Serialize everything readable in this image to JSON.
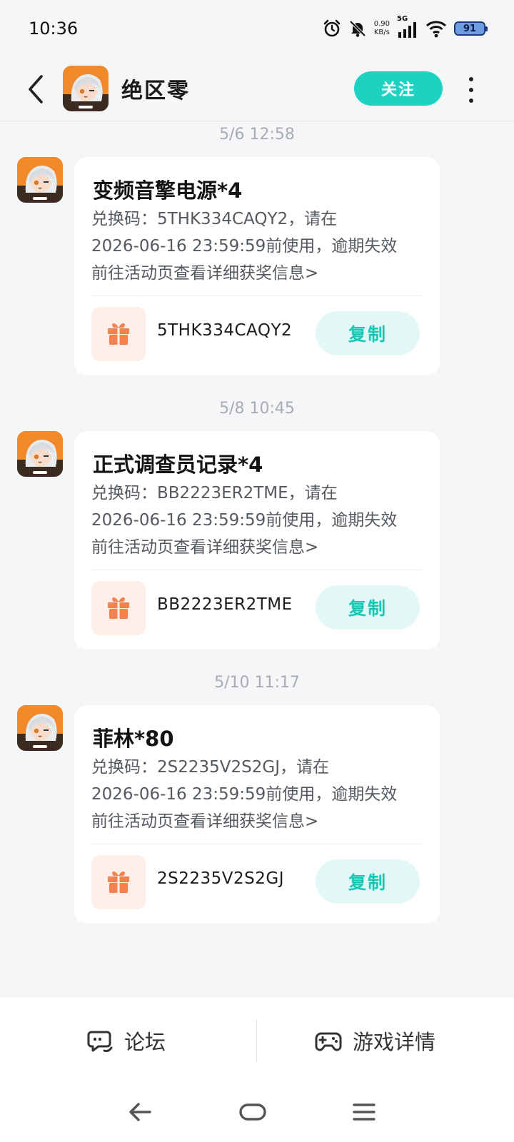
{
  "status_bar": {
    "time": "10:36",
    "net_speed_value": "0.90",
    "net_speed_unit": "KB/s",
    "signal_label": "5G",
    "battery": "91",
    "icons": [
      "alarm-icon",
      "mute-bell-icon",
      "signal-icon",
      "wifi-icon",
      "battery-icon"
    ]
  },
  "header": {
    "title": "绝区零",
    "follow_label": "关注",
    "icons": [
      "back-arrow-icon",
      "more-vertical-icon"
    ]
  },
  "messages": [
    {
      "time": "5/6  12:58",
      "title": "变频音擎电源*4",
      "body_line1": "兑换码：5THK334CAQY2，请在",
      "body_line2": "2026-06-16 23:59:59前使用，逾期失效",
      "body_line3": "前往活动页查看详细获奖信息>",
      "code": "5THK334CAQY2",
      "copy_label": "复制"
    },
    {
      "time": "5/8  10:45",
      "title": "正式调查员记录*4",
      "body_line1": "兑换码：BB2223ER2TME，请在",
      "body_line2": "2026-06-16 23:59:59前使用，逾期失效",
      "body_line3": "前往活动页查看详细获奖信息>",
      "code": "BB2223ER2TME",
      "copy_label": "复制"
    },
    {
      "time": "5/10  11:17",
      "title": "菲林*80",
      "body_line1": "兑换码：2S2235V2S2GJ，请在",
      "body_line2": "2026-06-16 23:59:59前使用，逾期失效",
      "body_line3": "前往活动页查看详细获奖信息>",
      "code": "2S2235V2S2GJ",
      "copy_label": "复制"
    }
  ],
  "bottom_bar": {
    "forum_label": "论坛",
    "game_detail_label": "游戏详情"
  },
  "colors": {
    "accent": "#1ed2c2",
    "copy_bg": "#e3f8f6",
    "gift": "#f4814f",
    "gift_bg": "#fdefe8",
    "page_bg": "#f5f6f8"
  }
}
